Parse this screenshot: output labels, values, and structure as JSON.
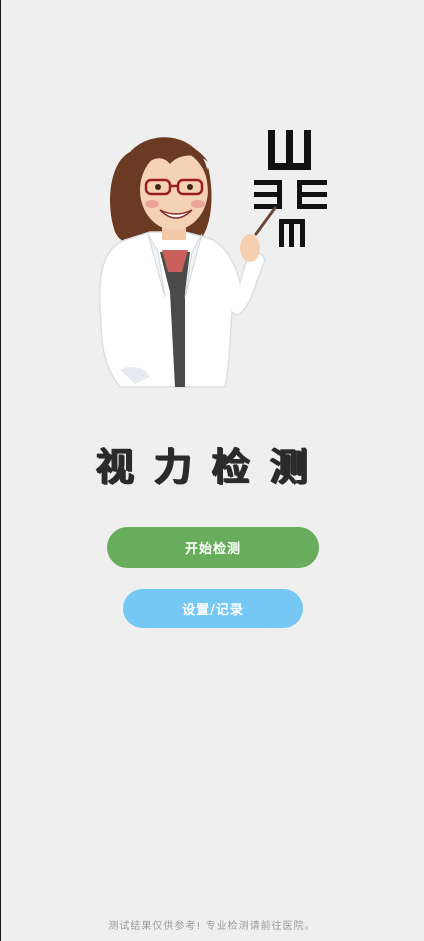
{
  "app": {
    "title": "视力检测"
  },
  "buttons": {
    "start_label": "开始检测",
    "settings_label": "设置/记录"
  },
  "footer": {
    "disclaimer": "测试结果仅供参考! 专业检测请前往医院。"
  },
  "colors": {
    "background": "#efefef",
    "start_button": "#68ad5b",
    "settings_button": "#76c8f4",
    "title": "#2b2b2b"
  },
  "icons": {
    "illustration": "doctor-with-eye-chart-illustration"
  }
}
